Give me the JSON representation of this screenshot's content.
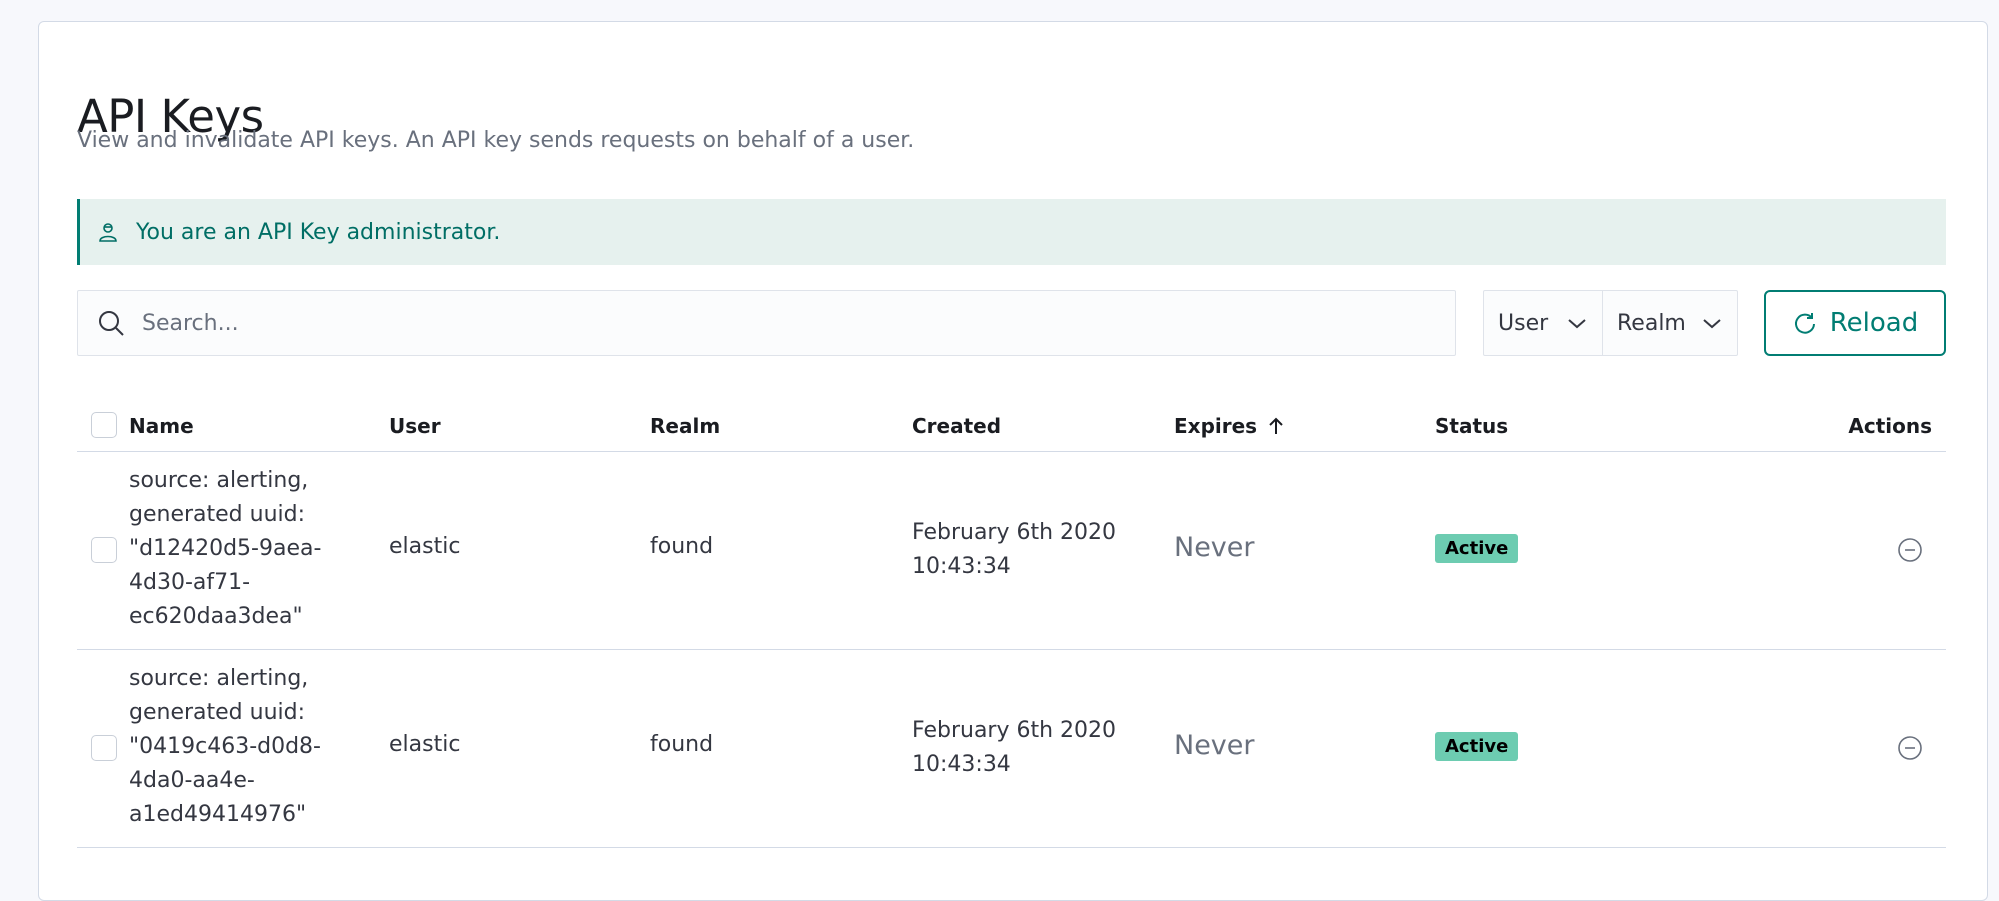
{
  "header": {
    "title": "API Keys",
    "subtitle": "View and invalidate API keys. An API key sends requests on behalf of a user."
  },
  "callout": {
    "text": "You are an API Key administrator.",
    "icon": "user-icon"
  },
  "search": {
    "placeholder": "Search...",
    "value": ""
  },
  "filters": {
    "user_label": "User",
    "realm_label": "Realm"
  },
  "reload_button": {
    "label": "Reload"
  },
  "table": {
    "columns": [
      "Name",
      "User",
      "Realm",
      "Created",
      "Expires",
      "Status",
      "Actions"
    ],
    "sort": {
      "column": "Expires",
      "direction": "ascending"
    },
    "rows": [
      {
        "name": "source: alerting,\ngenerated uuid:\n\"d12420d5-9aea-\n4d30-af71-\nec620daa3dea\"",
        "user": "elastic",
        "realm": "found",
        "created": "February 6th 2020\n10:43:34",
        "expires": "Never",
        "status": "Active"
      },
      {
        "name": "source: alerting,\ngenerated uuid:\n\"0419c463-d0d8-\n4da0-aa4e-\na1ed49414976\"",
        "user": "elastic",
        "realm": "found",
        "created": "February 6th 2020\n10:43:34",
        "expires": "Never",
        "status": "Active"
      }
    ]
  },
  "colors": {
    "accent": "#017d73",
    "callout_bg": "#e6f1ee",
    "badge_bg": "#6dccb1"
  }
}
